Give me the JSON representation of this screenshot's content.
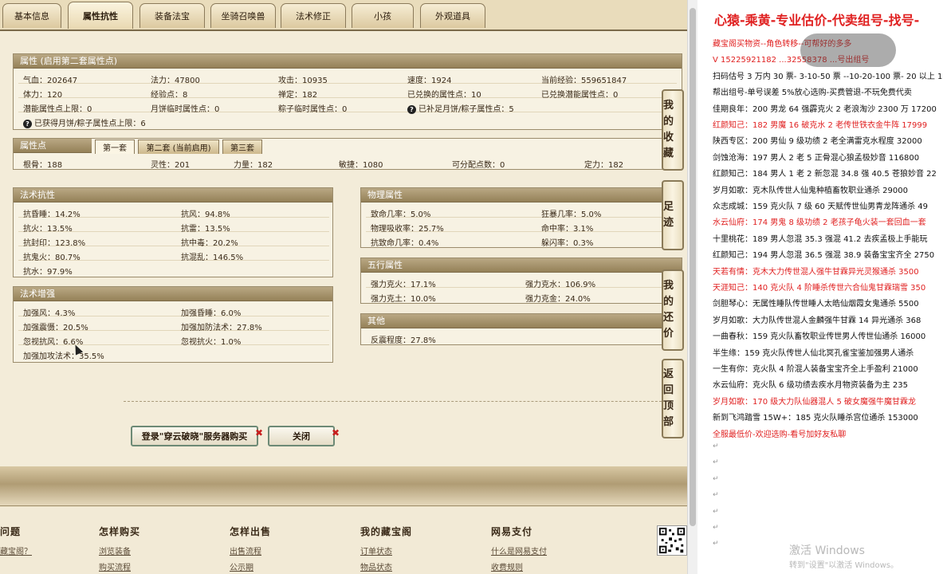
{
  "tabs": [
    "基本信息",
    "属性抗性",
    "装备法宝",
    "坐骑召唤兽",
    "法术修正",
    "小孩",
    "外观道具"
  ],
  "attr": {
    "title": "属性 (启用第二套属性点)",
    "rows": [
      [
        "气血：202647",
        "法力：47800",
        "攻击：10935",
        "速度：1924",
        "当前经验：559651847"
      ],
      [
        "体力：120",
        "经验点：8",
        "禅定：182",
        "已兑换的属性点：10",
        "已兑换潜能属性点：0"
      ],
      [
        "潜能属性点上限：0",
        "月饼临时属性点：0",
        "粽子临时属性点：0",
        "已补足月饼/粽子属性点：5",
        ""
      ]
    ],
    "note": "已获得月饼/粽子属性点上限：6",
    "q1": "?",
    "q2": "?"
  },
  "points": {
    "title": "属性点",
    "tabs": [
      "第一套",
      "第二套 (当前启用)",
      "第三套"
    ],
    "values": [
      "根骨：188",
      "灵性：201",
      "力量：182",
      "敏捷：1080",
      "可分配点数：0",
      "定力：182"
    ]
  },
  "resist": {
    "title": "法术抗性",
    "items": [
      "抗昏睡：14.2%",
      "抗风：94.8%",
      "抗火：13.5%",
      "抗雷：13.5%",
      "抗封印：123.8%",
      "抗中毒：20.2%",
      "抗鬼火：80.7%",
      "抗混乱：146.5%",
      "抗水：97.9%"
    ]
  },
  "enhance": {
    "title": "法术增强",
    "items": [
      "加强风：4.3%",
      "加强昏睡：6.0%",
      "加强震慑：20.5%",
      "加强加防法术：27.8%",
      "忽视抗风：6.6%",
      "忽视抗火：1.0%",
      "加强加攻法术：35.5%"
    ]
  },
  "physical": {
    "title": "物理属性",
    "items": [
      "致命几率：5.0%",
      "狂暴几率：5.0%",
      "物理吸收率：25.7%",
      "命中率：3.1%",
      "抗致命几率：0.4%",
      "躲闪率：0.3%"
    ]
  },
  "wuxing": {
    "title": "五行属性",
    "items": [
      "强力克火：17.1%",
      "强力克水：106.9%",
      "强力克土：10.0%",
      "强力克金：24.0%"
    ]
  },
  "other": {
    "title": "其他",
    "items": [
      "反震程度：27.8%"
    ]
  },
  "buttons": {
    "login": "登录\"穿云破晓\"服务器购买",
    "close": "关闭",
    "x": "✖"
  },
  "side": [
    "我的收藏",
    "足迹",
    "我的还价",
    "返回顶部"
  ],
  "footer": {
    "cols": [
      "问题",
      "怎样购买",
      "怎样出售",
      "我的藏宝阁",
      "网易支付"
    ],
    "links": [
      "藏宝阁？",
      "浏览装备",
      "购买流程",
      "出售流程",
      "公示期",
      "订单状态",
      "物品状态",
      "什么是网易支付",
      "收费规则"
    ]
  },
  "right": {
    "title": "心猿-乘黄-专业估价-代卖组号-找号-",
    "lines": [
      {
        "t": "藏宝阁买物资--角色转移--可帮好的多多",
        "c": "red"
      },
      {
        "t": "V 15225921182  ...32558378 ...号出组号",
        "c": "red"
      },
      {
        "t": "扫码估号 3 万内 30 票- 3-10-50 票  --10-20-100 票- 20 以上 1",
        "c": ""
      },
      {
        "t": "帮出组号-单号误差 5%放心选购-买费管退-不玩免费代卖",
        "c": ""
      },
      {
        "t": "佳期良年：200 男龙 64 强霹克火 2 老浪淘沙 2300 万 17200",
        "c": ""
      },
      {
        "t": "红颜知己：182 男魔 16 破克水 2 老传世铁衣金牛阵 17999",
        "c": "red"
      },
      {
        "t": "陕西专区：200 男仙 9 级功绩 2 老全满雷克水程度 32000",
        "c": ""
      },
      {
        "t": "剑蚀沧海：197 男人 2 老 5 正骨混心狼孟极妙音 116800",
        "c": ""
      },
      {
        "t": "红颜知己：184 男人 1 老 2 新忽混 34.8 强 40.5 苍狼妙音 22",
        "c": ""
      },
      {
        "t": "岁月如歌：克木队传世人仙鬼种植畜牧职业通杀 29000",
        "c": ""
      },
      {
        "t": "众志成城：159 克火队 7 级 60 天赋传世仙男青龙阵通杀 49",
        "c": ""
      },
      {
        "t": "水云仙府：174 男鬼 8 级功绩 2 老孩子龟火装一套回血一套",
        "c": "red"
      },
      {
        "t": "十里桃花：189 男人忽混 35.3 强混 41.2 去疾孟极上手能玩",
        "c": ""
      },
      {
        "t": "红颜知己：194 男人忽混 36.5 强混 38.9 装备宝宝齐全 2750",
        "c": ""
      },
      {
        "t": "天若有情：克木大力传世混人强牛甘霖异光灵猴通杀 3500",
        "c": "red"
      },
      {
        "t": "天涯知己：140 克火队 4 阶睡杀传世六合仙鬼甘霖瑞雪 350",
        "c": "red"
      },
      {
        "t": "剑胆琴心：无属性睡队传世睡人太皓仙烟霞女鬼通杀 5500",
        "c": ""
      },
      {
        "t": "岁月如歌：大力队传世混人金麟强牛甘霖 14 异光通杀 368",
        "c": ""
      },
      {
        "t": "一曲春秋：159 克火队畜牧职业传世男人传世仙通杀 16000",
        "c": ""
      },
      {
        "t": "半生缘：159 克火队传世人仙北冥孔雀宝鉴加强男人通杀",
        "c": ""
      },
      {
        "t": "一生有你：克火队 4 阶混人装备宝宝齐全上手盈利 21000",
        "c": ""
      },
      {
        "t": "水云仙府：克火队 6 级功绩去疾水月物资装备为主 235",
        "c": ""
      },
      {
        "t": "岁月如歌：170 级大力队仙器混人 5 破女魔强牛魔甘霖龙",
        "c": "red"
      },
      {
        "t": "新到飞鸿踏雪 15W+：185 克火队睡杀宫位通杀 153000",
        "c": ""
      },
      {
        "t": "全服最低价-欢迎选购-看号加好友私聊",
        "c": "red"
      }
    ],
    "ret": "↵",
    "win1": "激活 Windows",
    "win2": "转到\"设置\"以激活 Windows。"
  }
}
